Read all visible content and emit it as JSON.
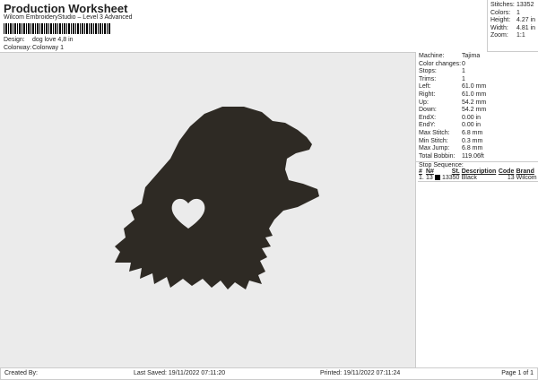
{
  "header": {
    "title": "Production Worksheet",
    "subtitle": "Wilcom EmbroideryStudio – Level 3 Advanced",
    "design_label": "Design:",
    "design_value": "dog love 4,8 in",
    "colorway_label": "Colorway:",
    "colorway_value": "Colorway 1"
  },
  "summary": [
    {
      "k": "Stitches:",
      "v": "13352"
    },
    {
      "k": "Colors:",
      "v": "1"
    },
    {
      "k": "Height:",
      "v": "4.27 in"
    },
    {
      "k": "Width:",
      "v": "4.81 in"
    },
    {
      "k": "Zoom:",
      "v": "1:1"
    }
  ],
  "details": [
    {
      "k": "Machine:",
      "v": "Tajima"
    },
    {
      "k": "Color changes:",
      "v": "0"
    },
    {
      "k": "Stops:",
      "v": "1"
    },
    {
      "k": "Trims:",
      "v": "1"
    },
    {
      "k": "Left:",
      "v": "61.0 mm"
    },
    {
      "k": "Right:",
      "v": "61.0 mm"
    },
    {
      "k": "Up:",
      "v": "54.2 mm"
    },
    {
      "k": "Down:",
      "v": "54.2 mm"
    },
    {
      "k": "EndX:",
      "v": "0.00 in"
    },
    {
      "k": "EndY:",
      "v": "0.00 in"
    },
    {
      "k": "Max Stitch:",
      "v": "6.8 mm"
    },
    {
      "k": "Min Stitch:",
      "v": "0.3 mm"
    },
    {
      "k": "Max Jump:",
      "v": "6.8 mm"
    },
    {
      "k": "Total Bobbin:",
      "v": "119.06ft"
    }
  ],
  "stop_sequence": {
    "title": "Stop Sequence:",
    "headers": [
      "#",
      "N#",
      "St.",
      "Description",
      "Code",
      "Brand"
    ],
    "rows": [
      {
        "num": "1.",
        "n": "13",
        "color": "#000000",
        "st": "13350",
        "desc": "Black",
        "code": "13",
        "brand": "Wilcom"
      }
    ]
  },
  "footer": {
    "created": "Created By:",
    "saved": "Last Saved: 19/11/2022 07:11:20",
    "printed": "Printed: 19/11/2022 07:11:24",
    "page": "Page 1 of 1"
  },
  "design_color": "#2e2a24"
}
